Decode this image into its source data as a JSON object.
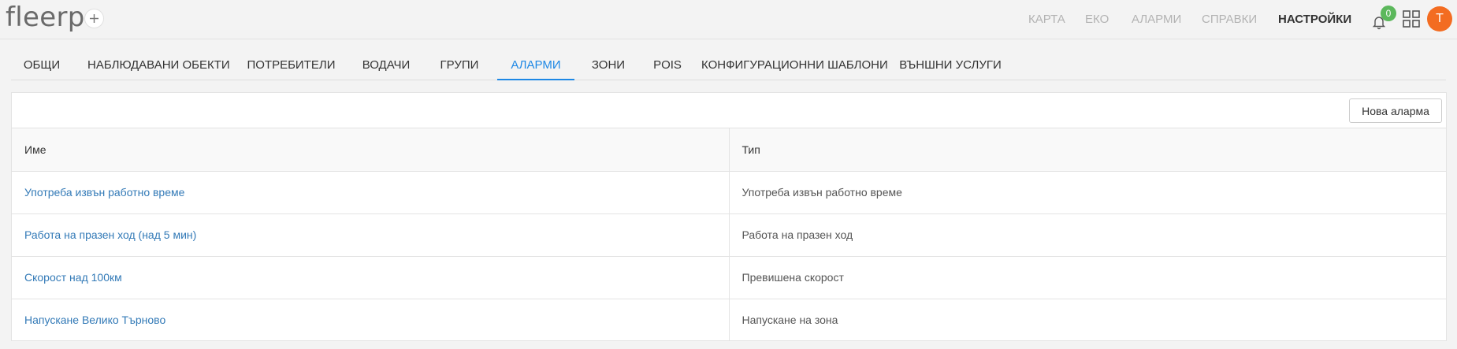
{
  "app": {
    "logo": "fleerp",
    "notification_count": "0",
    "avatar_initial": "T"
  },
  "nav": {
    "map": "КАРТА",
    "eco": "ЕКО",
    "alarms": "АЛАРМИ",
    "reports": "СПРАВКИ",
    "settings": "НАСТРОЙКИ"
  },
  "tabs": [
    {
      "label": "ОБЩИ"
    },
    {
      "label": "НАБЛЮДАВАНИ ОБЕКТИ"
    },
    {
      "label": "ПОТРЕБИТЕЛИ"
    },
    {
      "label": "ВОДАЧИ"
    },
    {
      "label": "ГРУПИ"
    },
    {
      "label": "АЛАРМИ"
    },
    {
      "label": "ЗОНИ"
    },
    {
      "label": "POIS"
    },
    {
      "label": "КОНФИГУРАЦИОННИ ШАБЛОНИ"
    },
    {
      "label": "ВЪНШНИ УСЛУГИ"
    }
  ],
  "toolbar": {
    "new_alarm_label": "Нова аларма"
  },
  "table": {
    "headers": {
      "name": "Име",
      "type": "Тип"
    },
    "rows": [
      {
        "name": "Употреба извън работно време",
        "type": "Употреба извън работно време"
      },
      {
        "name": "Работа на празен ход (над 5 мин)",
        "type": "Работа на празен ход"
      },
      {
        "name": "Скорост над 100км",
        "type": "Превишена скорост"
      },
      {
        "name": "Напускане Велико Търново",
        "type": "Напускане на зона"
      }
    ]
  },
  "colors": {
    "accent": "#1e88e5",
    "link": "#337ab7",
    "badge": "#5cb85c",
    "avatar": "#f36c21"
  }
}
